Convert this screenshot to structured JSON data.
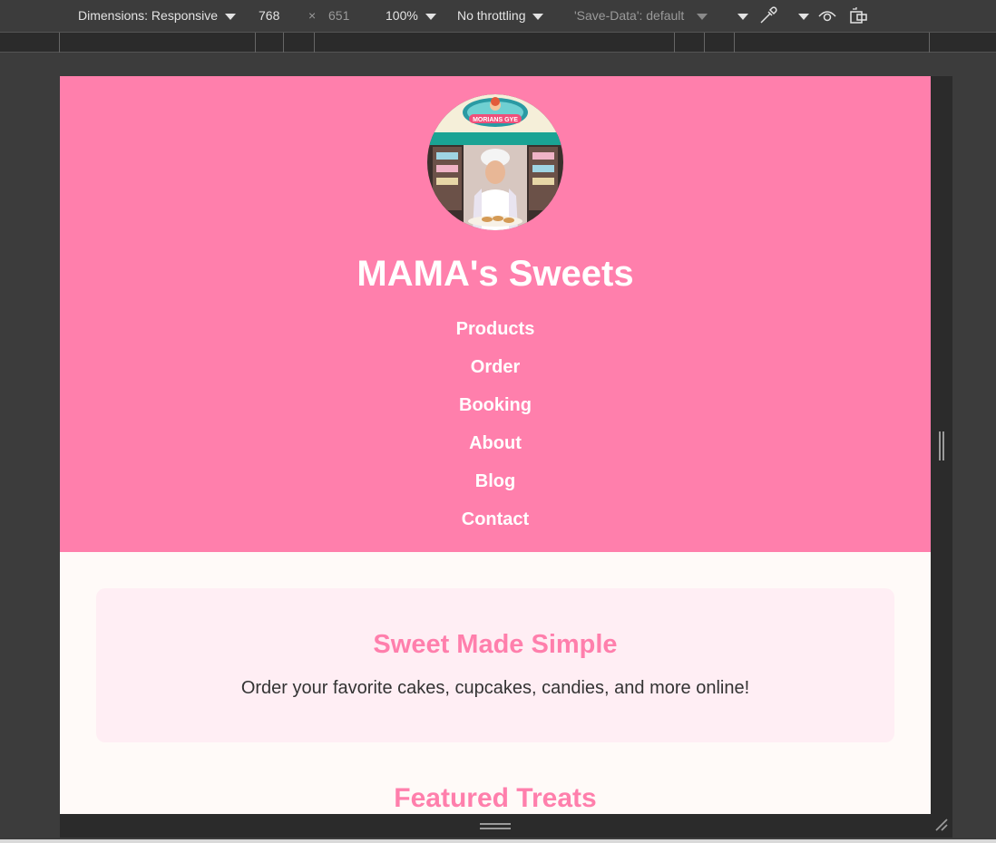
{
  "devtools": {
    "dimensions_label": "Dimensions: Responsive",
    "width_value": "768",
    "times": "×",
    "height_value": "651",
    "zoom": "100%",
    "throttling": "No throttling",
    "save_data": "'Save-Data': default"
  },
  "site": {
    "title": "MAMA's Sweets",
    "nav": [
      "Products",
      "Order",
      "Booking",
      "About",
      "Blog",
      "Contact"
    ],
    "hero_heading": "Sweet Made Simple",
    "hero_text": "Order your favorite cakes, cupcakes, candies, and more online!",
    "featured_heading": "Featured Treats",
    "logo_sign_text": "MORIANS GYE"
  },
  "colors": {
    "header_bg": "#ff7fac",
    "accent": "#ff7fac",
    "hero_bg": "#ffeef4",
    "page_bg": "#fffaf8"
  }
}
